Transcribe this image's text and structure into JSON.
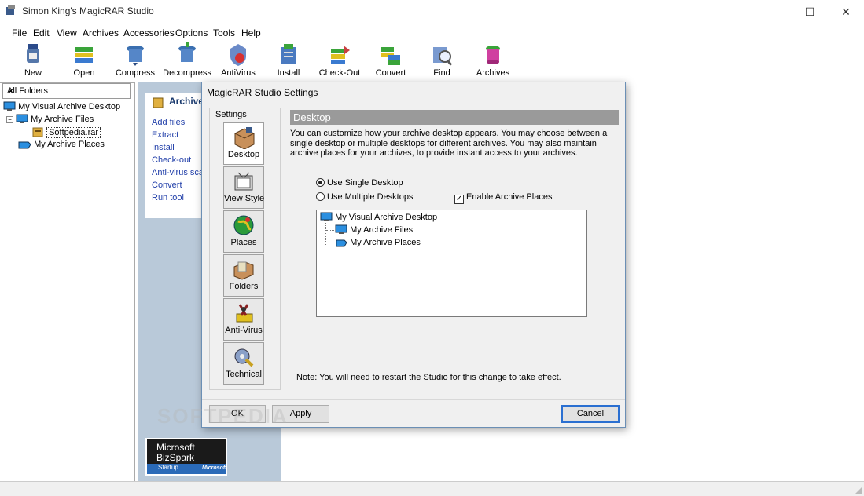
{
  "window": {
    "title": "Simon King's MagicRAR Studio",
    "minimize": "—",
    "maximize": "☐",
    "close": "✕"
  },
  "menu": [
    "File",
    "Edit",
    "View",
    "Archives",
    "Accessories",
    "Options",
    "Tools",
    "Help"
  ],
  "toolbar": [
    {
      "label": "New",
      "icon": "new-icon"
    },
    {
      "label": "Open",
      "icon": "open-icon"
    },
    {
      "label": "Compress",
      "icon": "compress-icon"
    },
    {
      "label": "Decompress",
      "icon": "decompress-icon"
    },
    {
      "label": "AntiVirus",
      "icon": "antivirus-icon"
    },
    {
      "label": "Install",
      "icon": "install-icon"
    },
    {
      "label": "Check-Out",
      "icon": "checkout-icon"
    },
    {
      "label": "Convert",
      "icon": "convert-icon"
    },
    {
      "label": "Find",
      "icon": "find-icon"
    },
    {
      "label": "Archives",
      "icon": "archives-icon"
    }
  ],
  "left_panel": {
    "header": "All Folders",
    "close": "✕",
    "tree": [
      {
        "label": "My Visual Archive Desktop",
        "level": 0
      },
      {
        "label": "My Archive Files",
        "level": 1
      },
      {
        "label": "Softpedia.rar",
        "level": 2,
        "selected": true
      },
      {
        "label": "My Archive Places",
        "level": 1
      }
    ]
  },
  "task_panel": {
    "title": "Archive",
    "links": [
      "Add files",
      "Extract",
      "Install",
      "Check-out",
      "Anti-virus sca",
      "Convert",
      "Run tool"
    ]
  },
  "bizspark": {
    "line1": "Microsoft",
    "line2": "BizSpark",
    "line3": "Startup",
    "brand": "Microsoft"
  },
  "watermark": "SOFTPEDIA",
  "dialog": {
    "title": "MagicRAR Studio Settings",
    "settings_label": "Settings",
    "nav": [
      {
        "label": "Desktop",
        "icon": "desktop-settings-icon",
        "active": true
      },
      {
        "label": "View Style",
        "icon": "view-style-icon"
      },
      {
        "label": "Places",
        "icon": "places-icon"
      },
      {
        "label": "Folders",
        "icon": "folders-icon"
      },
      {
        "label": "Anti-Virus",
        "icon": "anti-virus-settings-icon"
      },
      {
        "label": "Technical",
        "icon": "technical-icon"
      }
    ],
    "section_title": "Desktop",
    "description": "You can customize how your archive desktop appears. You may choose between a single desktop or multiple desktops for different archives. You may also maintain archive places for your archives, to provide instant access to your archives.",
    "option_single": "Use Single Desktop",
    "option_multiple": "Use Multiple Desktops",
    "option_places": "Enable Archive Places",
    "single_selected": true,
    "places_checked": true,
    "desktop_tree": [
      "My Visual Archive Desktop",
      "My Archive Files",
      "My Archive Places"
    ],
    "note": "Note: You will need to restart the Studio for this change to take effect.",
    "ok": "OK",
    "apply": "Apply",
    "cancel": "Cancel"
  },
  "colors": {
    "accent": "#2a6fd1",
    "middle_bg": "#b9c9d9",
    "section_header": "#9a9a9a",
    "link": "#1f3da8"
  }
}
